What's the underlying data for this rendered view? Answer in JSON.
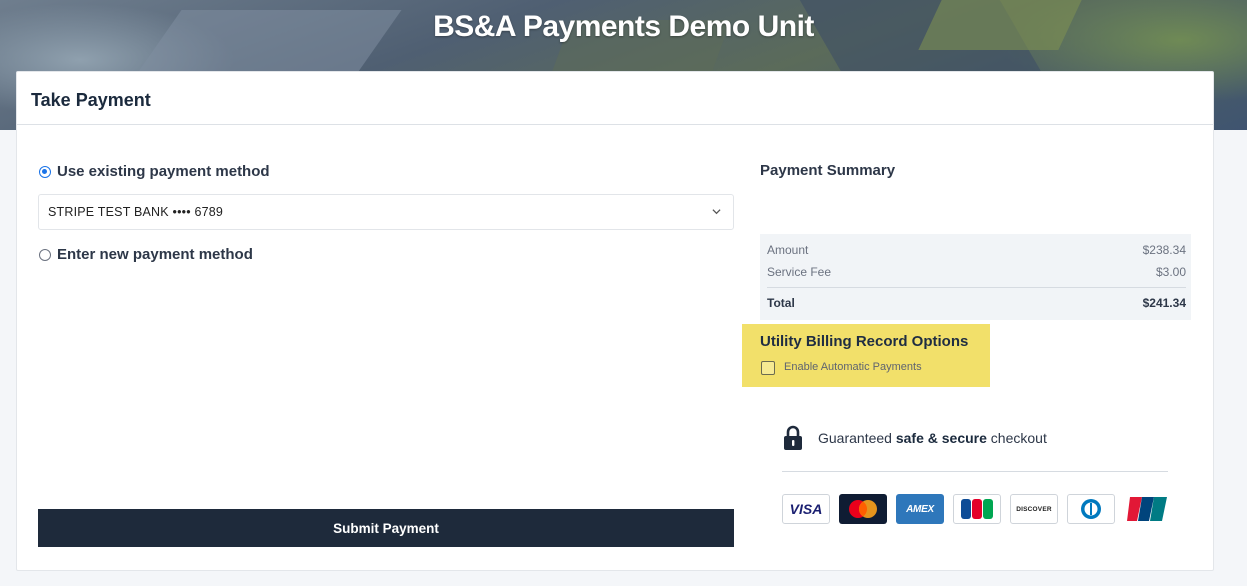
{
  "header": {
    "title": "BS&A Payments Demo Unit"
  },
  "card": {
    "title": "Take Payment"
  },
  "payment_options": {
    "existing_label": "Use existing payment method",
    "existing_selected": true,
    "selected_method": "STRIPE TEST BANK •••• 6789",
    "new_label": "Enter new payment method",
    "new_selected": false
  },
  "submit_label": "Submit Payment",
  "summary": {
    "title": "Payment Summary",
    "rows": [
      {
        "label": "Amount",
        "value": "$238.34"
      },
      {
        "label": "Service Fee",
        "value": "$3.00"
      }
    ],
    "total": {
      "label": "Total",
      "value": "$241.34"
    }
  },
  "utility_options": {
    "title": "Utility Billing Record Options",
    "checkbox_label": "Enable Automatic Payments",
    "checked": false,
    "highlight_color": "#f2e06a"
  },
  "secure": {
    "prefix": "Guaranteed",
    "bold": "safe & secure",
    "suffix": "checkout"
  },
  "card_brands": {
    "visa": "VISA",
    "amex": "AMEX",
    "discover": "DISCOVER",
    "icons": [
      "visa-icon",
      "mastercard-icon",
      "amex-icon",
      "jcb-icon",
      "discover-icon",
      "diners-icon",
      "unionpay-icon"
    ]
  },
  "colors": {
    "accent": "#1a73e8",
    "submit_bg": "#1e2a3b"
  }
}
